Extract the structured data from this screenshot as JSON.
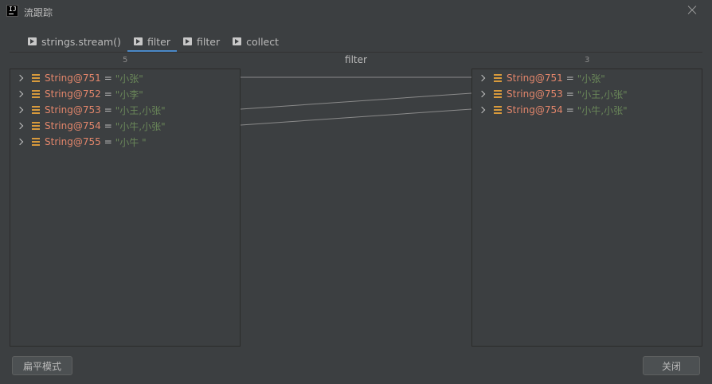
{
  "window": {
    "title": "流跟踪"
  },
  "tabs": [
    {
      "label": "strings.stream()",
      "active": false
    },
    {
      "label": "filter",
      "active": true
    },
    {
      "label": "filter",
      "active": false
    },
    {
      "label": "collect",
      "active": false
    }
  ],
  "left_panel": {
    "count": "5",
    "items": [
      {
        "name": "String@751",
        "eq": "=",
        "value": "\"小张\""
      },
      {
        "name": "String@752",
        "eq": "=",
        "value": "\"小李\""
      },
      {
        "name": "String@753",
        "eq": "=",
        "value": "\"小王,小张\""
      },
      {
        "name": "String@754",
        "eq": "=",
        "value": "\"小牛,小张\""
      },
      {
        "name": "String@755",
        "eq": "=",
        "value": "\"小牛 \""
      }
    ]
  },
  "operation_label": "filter",
  "right_panel": {
    "count": "3",
    "items": [
      {
        "name": "String@751",
        "eq": "=",
        "value": "\"小张\""
      },
      {
        "name": "String@753",
        "eq": "=",
        "value": "\"小王,小张\""
      },
      {
        "name": "String@754",
        "eq": "=",
        "value": "\"小牛,小张\""
      }
    ]
  },
  "mappings": [
    [
      0,
      0
    ],
    [
      2,
      1
    ],
    [
      3,
      2
    ]
  ],
  "buttons": {
    "flat_mode": "扁平模式",
    "close": "关闭"
  },
  "colors": {
    "accent": "#4a88c7",
    "name": "#e3866b",
    "value": "#6a8759",
    "icon": "#d89a3c"
  }
}
